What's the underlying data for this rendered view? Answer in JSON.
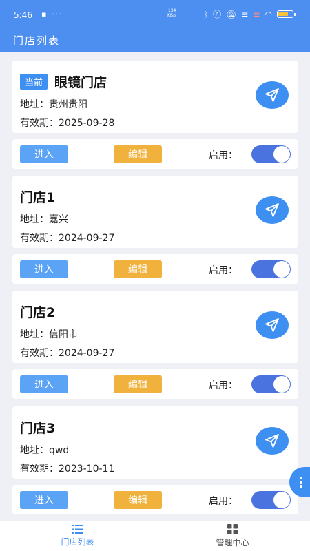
{
  "status_bar": {
    "time": "5:46",
    "left_icons": "▪ ···",
    "net_speed_value": "134",
    "net_speed_unit": "KB/s",
    "icons": [
      "bluetooth-icon",
      "nfc-icon",
      "mute-icon",
      "signal-icon",
      "signal-icon-2",
      "wifi-icon",
      "battery-icon"
    ]
  },
  "header": {
    "title": "门店列表"
  },
  "labels": {
    "current": "当前",
    "address_prefix": "地址：",
    "valid_prefix": "有效期：",
    "enter": "进入",
    "edit": "编辑",
    "enable": "启用："
  },
  "stores": [
    {
      "name": "眼镜门店",
      "address": "贵州贵阳",
      "valid_until": "2025-09-28",
      "is_current": true,
      "enabled": true
    },
    {
      "name": "门店1",
      "address": "嘉兴",
      "valid_until": "2024-09-27",
      "is_current": false,
      "enabled": true
    },
    {
      "name": "门店2",
      "address": "信阳市",
      "valid_until": "2024-09-27",
      "is_current": false,
      "enabled": true
    },
    {
      "name": "门店3",
      "address": "qwd",
      "valid_until": "2023-10-11",
      "is_current": false,
      "enabled": true
    }
  ],
  "tabbar": [
    {
      "label": "门店列表",
      "icon": "list-icon",
      "active": true
    },
    {
      "label": "管理中心",
      "icon": "grid-icon",
      "active": false
    }
  ],
  "colors": {
    "primary": "#4d8ff0",
    "accent_blue": "#3e8ff2",
    "edit_orange": "#f0b23c",
    "toggle_on": "#4a73e0"
  }
}
